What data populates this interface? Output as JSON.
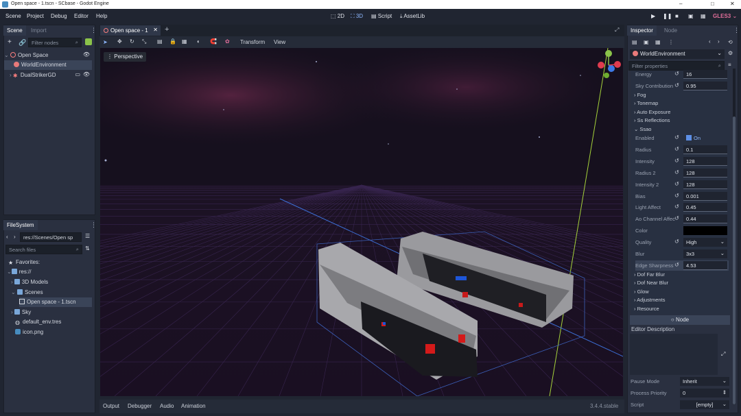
{
  "window": {
    "title": "Open space - 1.tscn - SCbase - Godot Engine",
    "controls": [
      "–",
      "□",
      "✕"
    ]
  },
  "menu": [
    "Scene",
    "Project",
    "Debug",
    "Editor",
    "Help"
  ],
  "workspaces": [
    {
      "label": "2D"
    },
    {
      "label": "3D",
      "active": true
    },
    {
      "label": "Script"
    },
    {
      "label": "AssetLib"
    }
  ],
  "renderer": "GLES3",
  "scene_dock": {
    "tabs": [
      "Scene",
      "Import"
    ],
    "filter_placeholder": "Filter nodes",
    "tree": [
      {
        "label": "Open Space",
        "depth": 0,
        "icon": "node3d-icon"
      },
      {
        "label": "WorldEnvironment",
        "depth": 1,
        "icon": "world-env-icon",
        "selected": true
      },
      {
        "label": "DualStrikerGD",
        "depth": 1,
        "icon": "node-icon"
      }
    ]
  },
  "filesystem": {
    "tab": "FileSystem",
    "path": "res://Scenes/Open sp",
    "search_placeholder": "Search files",
    "items": [
      {
        "label": "Favorites:",
        "depth": 0,
        "icon": "star-icon"
      },
      {
        "label": "res://",
        "depth": 0,
        "icon": "folder-icon"
      },
      {
        "label": "3D Models",
        "depth": 1,
        "icon": "folder-icon"
      },
      {
        "label": "Scenes",
        "depth": 1,
        "icon": "folder-icon"
      },
      {
        "label": "Open space - 1.tscn",
        "depth": 2,
        "icon": "scene-file-icon",
        "selected": true
      },
      {
        "label": "Sky",
        "depth": 1,
        "icon": "folder-icon"
      },
      {
        "label": "default_env.tres",
        "depth": 1,
        "icon": "globe-icon"
      },
      {
        "label": "icon.png",
        "depth": 1,
        "icon": "image-icon"
      }
    ]
  },
  "editor": {
    "scene_tab": "Open space - 1",
    "toolbar_menus": [
      "Transform",
      "View"
    ],
    "viewport_label": "Perspective"
  },
  "bottom_panel": {
    "tabs": [
      "Output",
      "Debugger",
      "Audio",
      "Animation"
    ],
    "version": "3.4.4.stable"
  },
  "inspector": {
    "tabs": [
      "Inspector",
      "Node"
    ],
    "object": "WorldEnvironment",
    "filter_placeholder": "Filter properties",
    "props_top": [
      {
        "label": "Energy",
        "value": "16"
      },
      {
        "label": "Sky Contribution",
        "value": "0.95"
      }
    ],
    "sections": [
      "Fog",
      "Tonemap",
      "Auto Exposure",
      "Ss Reflections",
      "Ssao"
    ],
    "ssao": [
      {
        "label": "Enabled",
        "value": "On"
      },
      {
        "label": "Radius",
        "value": "0.1"
      },
      {
        "label": "Intensity",
        "value": "128"
      },
      {
        "label": "Radius 2",
        "value": "128"
      },
      {
        "label": "Intensity 2",
        "value": "128"
      },
      {
        "label": "Bias",
        "value": "0.001"
      },
      {
        "label": "Light Affect",
        "value": "0.45"
      },
      {
        "label": "Ao Channel Affect",
        "value": "0.44"
      },
      {
        "label": "Color",
        "value": ""
      },
      {
        "label": "Quality",
        "value": "High"
      },
      {
        "label": "Blur",
        "value": "3x3"
      },
      {
        "label": "Edge Sharpness",
        "value": "4.53"
      }
    ],
    "sections_bottom": [
      "Dof Far Blur",
      "Dof Near Blur",
      "Glow",
      "Adjustments",
      "Resource"
    ],
    "node_button": "Node",
    "editor_description": "Editor Description",
    "footer": [
      {
        "label": "Pause Mode",
        "value": "Inherit"
      },
      {
        "label": "Process Priority",
        "value": "0"
      },
      {
        "label": "Script",
        "value": "[empty]"
      }
    ]
  },
  "colors": {
    "accent": "#8eb8ff",
    "renderer": "#e16e9a",
    "panel": "#2a3040",
    "bg": "#202531"
  }
}
